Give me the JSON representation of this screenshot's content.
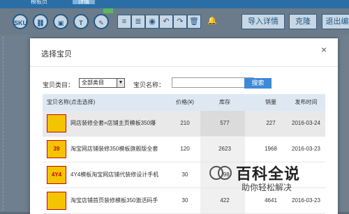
{
  "topbar": {
    "tabs": [
      "模板页",
      "详情"
    ]
  },
  "toolbar": {
    "sku": "SKU",
    "icons": [
      "link-icon",
      "image-icon",
      "text-icon",
      "pen-icon",
      "align-left-icon",
      "align-right-icon",
      "compass-icon",
      "undo-icon",
      "redo-icon",
      "trash-icon",
      "bell-icon"
    ],
    "import_label": "导入详情",
    "clone_label": "克隆",
    "exit_label": "退出编"
  },
  "modal": {
    "title": "选择宝贝",
    "close": "×",
    "category_label": "宝贝类目：",
    "category_value": "全部类目",
    "name_label": "宝贝名称：",
    "search_button": "搜索"
  },
  "table": {
    "headers": [
      "宝贝名称(点击选择)",
      "价格(¥)",
      "库存",
      "销量",
      "发布时间"
    ],
    "rows": [
      {
        "thumb": "",
        "name": "网店装修全套=店铺主页模板350爆",
        "price": "210",
        "stock": "577",
        "sales": "227",
        "date": "2016-03-24"
      },
      {
        "thumb": "39",
        "name": "淘宝网店铺装修350模板旗舰版全套",
        "price": "120",
        "stock": "2623",
        "sales": "1968",
        "date": "2016-03-23"
      },
      {
        "thumb": "4Y4",
        "name": "4Y4模板淘宝网店铺代装修设计手机",
        "price": "30",
        "stock": "398",
        "sales": "",
        "date": ""
      },
      {
        "thumb": "",
        "name": "淘宝店铺首页装修模板350激活码手",
        "price": "30",
        "stock": "422",
        "sales": "4641",
        "date": "2016-03-23"
      }
    ]
  },
  "watermark": {
    "title": "百科全说",
    "subtitle": "助你轻松解决"
  }
}
